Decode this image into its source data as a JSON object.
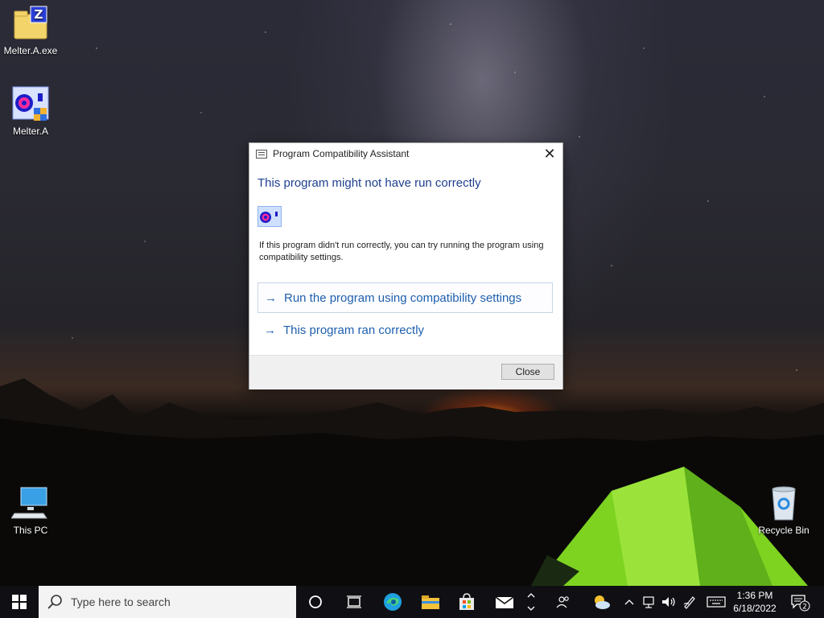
{
  "desktop": {
    "icons": [
      {
        "label": "Melter.A.exe",
        "icon": "zip-folder-icon"
      },
      {
        "label": "Melter.A",
        "icon": "melter-app-icon"
      },
      {
        "label": "This PC",
        "icon": "computer-icon"
      },
      {
        "label": "Recycle Bin",
        "icon": "recycle-bin-icon"
      }
    ]
  },
  "dialog": {
    "title": "Program Compatibility Assistant",
    "close_glyph": "✕",
    "heading": "This program might not have run correctly",
    "description": "If this program didn't run correctly, you can try running the program using compatibility settings.",
    "options": [
      {
        "arrow": "→",
        "label": "Run the program using compatibility settings"
      },
      {
        "arrow": "→",
        "label": "This program ran correctly"
      }
    ],
    "close_button": "Close"
  },
  "taskbar": {
    "search_placeholder": "Type here to search",
    "pinned": [
      "cortana-icon",
      "task-view-icon",
      "edge-icon",
      "file-explorer-icon",
      "store-icon",
      "mail-icon"
    ],
    "tray": [
      "people-icon",
      "weather-icon",
      "chevron-up-icon",
      "network-icon",
      "volume-icon",
      "pen-icon",
      "keyboard-icon"
    ],
    "time": "1:36 PM",
    "date": "6/18/2022",
    "notification_count": "2"
  },
  "colors": {
    "heading": "#1f3f8e",
    "link": "#1e5fae",
    "taskbar": "#101014",
    "tent": "#7ed321"
  }
}
